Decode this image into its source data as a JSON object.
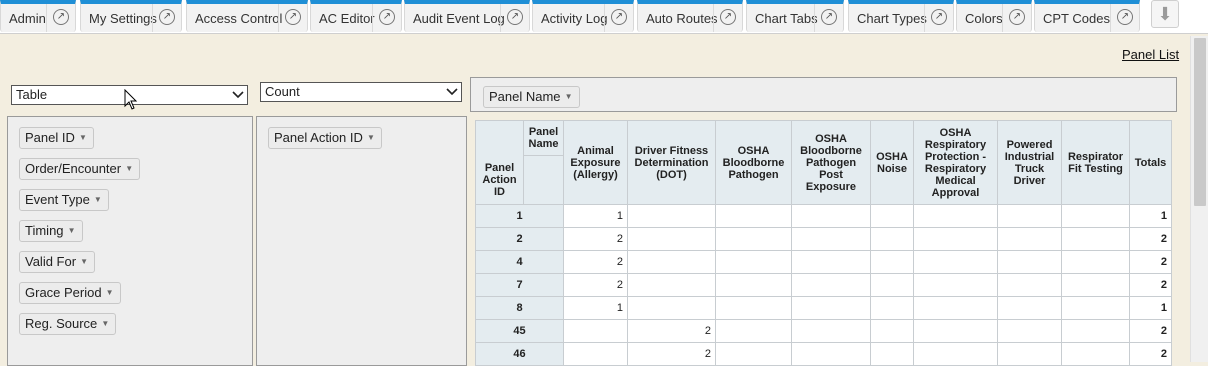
{
  "tabs": [
    {
      "label": "Admin"
    },
    {
      "label": "My Settings"
    },
    {
      "label": "Access Control"
    },
    {
      "label": "AC Editor"
    },
    {
      "label": "Audit Event Log"
    },
    {
      "label": "Activity Log"
    },
    {
      "label": "Auto Routes"
    },
    {
      "label": "Chart Tabs"
    },
    {
      "label": "Chart Types"
    },
    {
      "label": "Colors"
    },
    {
      "label": "CPT Codes"
    }
  ],
  "panel_list_link": "Panel List",
  "renderer_select": {
    "value": "Table"
  },
  "aggregator_select": {
    "value": "Count"
  },
  "column_attr": {
    "label": "Panel Name"
  },
  "row_attr": {
    "label": "Panel Action ID"
  },
  "unused_attrs": [
    {
      "label": "Panel ID"
    },
    {
      "label": "Order/Encounter"
    },
    {
      "label": "Event Type"
    },
    {
      "label": "Timing"
    },
    {
      "label": "Valid For"
    },
    {
      "label": "Grace Period"
    },
    {
      "label": "Reg. Source"
    }
  ],
  "grid": {
    "col_axis_label": "Panel Name",
    "row_axis_label": "Panel Action ID",
    "columns": [
      "Animal Exposure (Allergy)",
      "Driver Fitness Determination (DOT)",
      "OSHA Bloodborne Pathogen",
      "OSHA Bloodborne Pathogen Post Exposure",
      "OSHA Noise",
      "OSHA Respiratory Protection - Respiratory Medical Approval",
      "Powered Industrial Truck Driver",
      "Respirator Fit Testing"
    ],
    "totals_label": "Totals",
    "rows": [
      {
        "id": "1",
        "cells": [
          "1",
          "",
          "",
          "",
          "",
          "",
          "",
          ""
        ],
        "total": "1"
      },
      {
        "id": "2",
        "cells": [
          "2",
          "",
          "",
          "",
          "",
          "",
          "",
          ""
        ],
        "total": "2"
      },
      {
        "id": "4",
        "cells": [
          "2",
          "",
          "",
          "",
          "",
          "",
          "",
          ""
        ],
        "total": "2"
      },
      {
        "id": "7",
        "cells": [
          "2",
          "",
          "",
          "",
          "",
          "",
          "",
          ""
        ],
        "total": "2"
      },
      {
        "id": "8",
        "cells": [
          "1",
          "",
          "",
          "",
          "",
          "",
          "",
          ""
        ],
        "total": "1"
      },
      {
        "id": "45",
        "cells": [
          "",
          "2",
          "",
          "",
          "",
          "",
          "",
          ""
        ],
        "total": "2"
      },
      {
        "id": "46",
        "cells": [
          "",
          "2",
          "",
          "",
          "",
          "",
          "",
          ""
        ],
        "total": "2"
      }
    ]
  },
  "colors": {
    "tab_accent": "#1f8fd6",
    "page_bg": "#f3eee0",
    "grid_header_bg": "#e4ecf0"
  }
}
